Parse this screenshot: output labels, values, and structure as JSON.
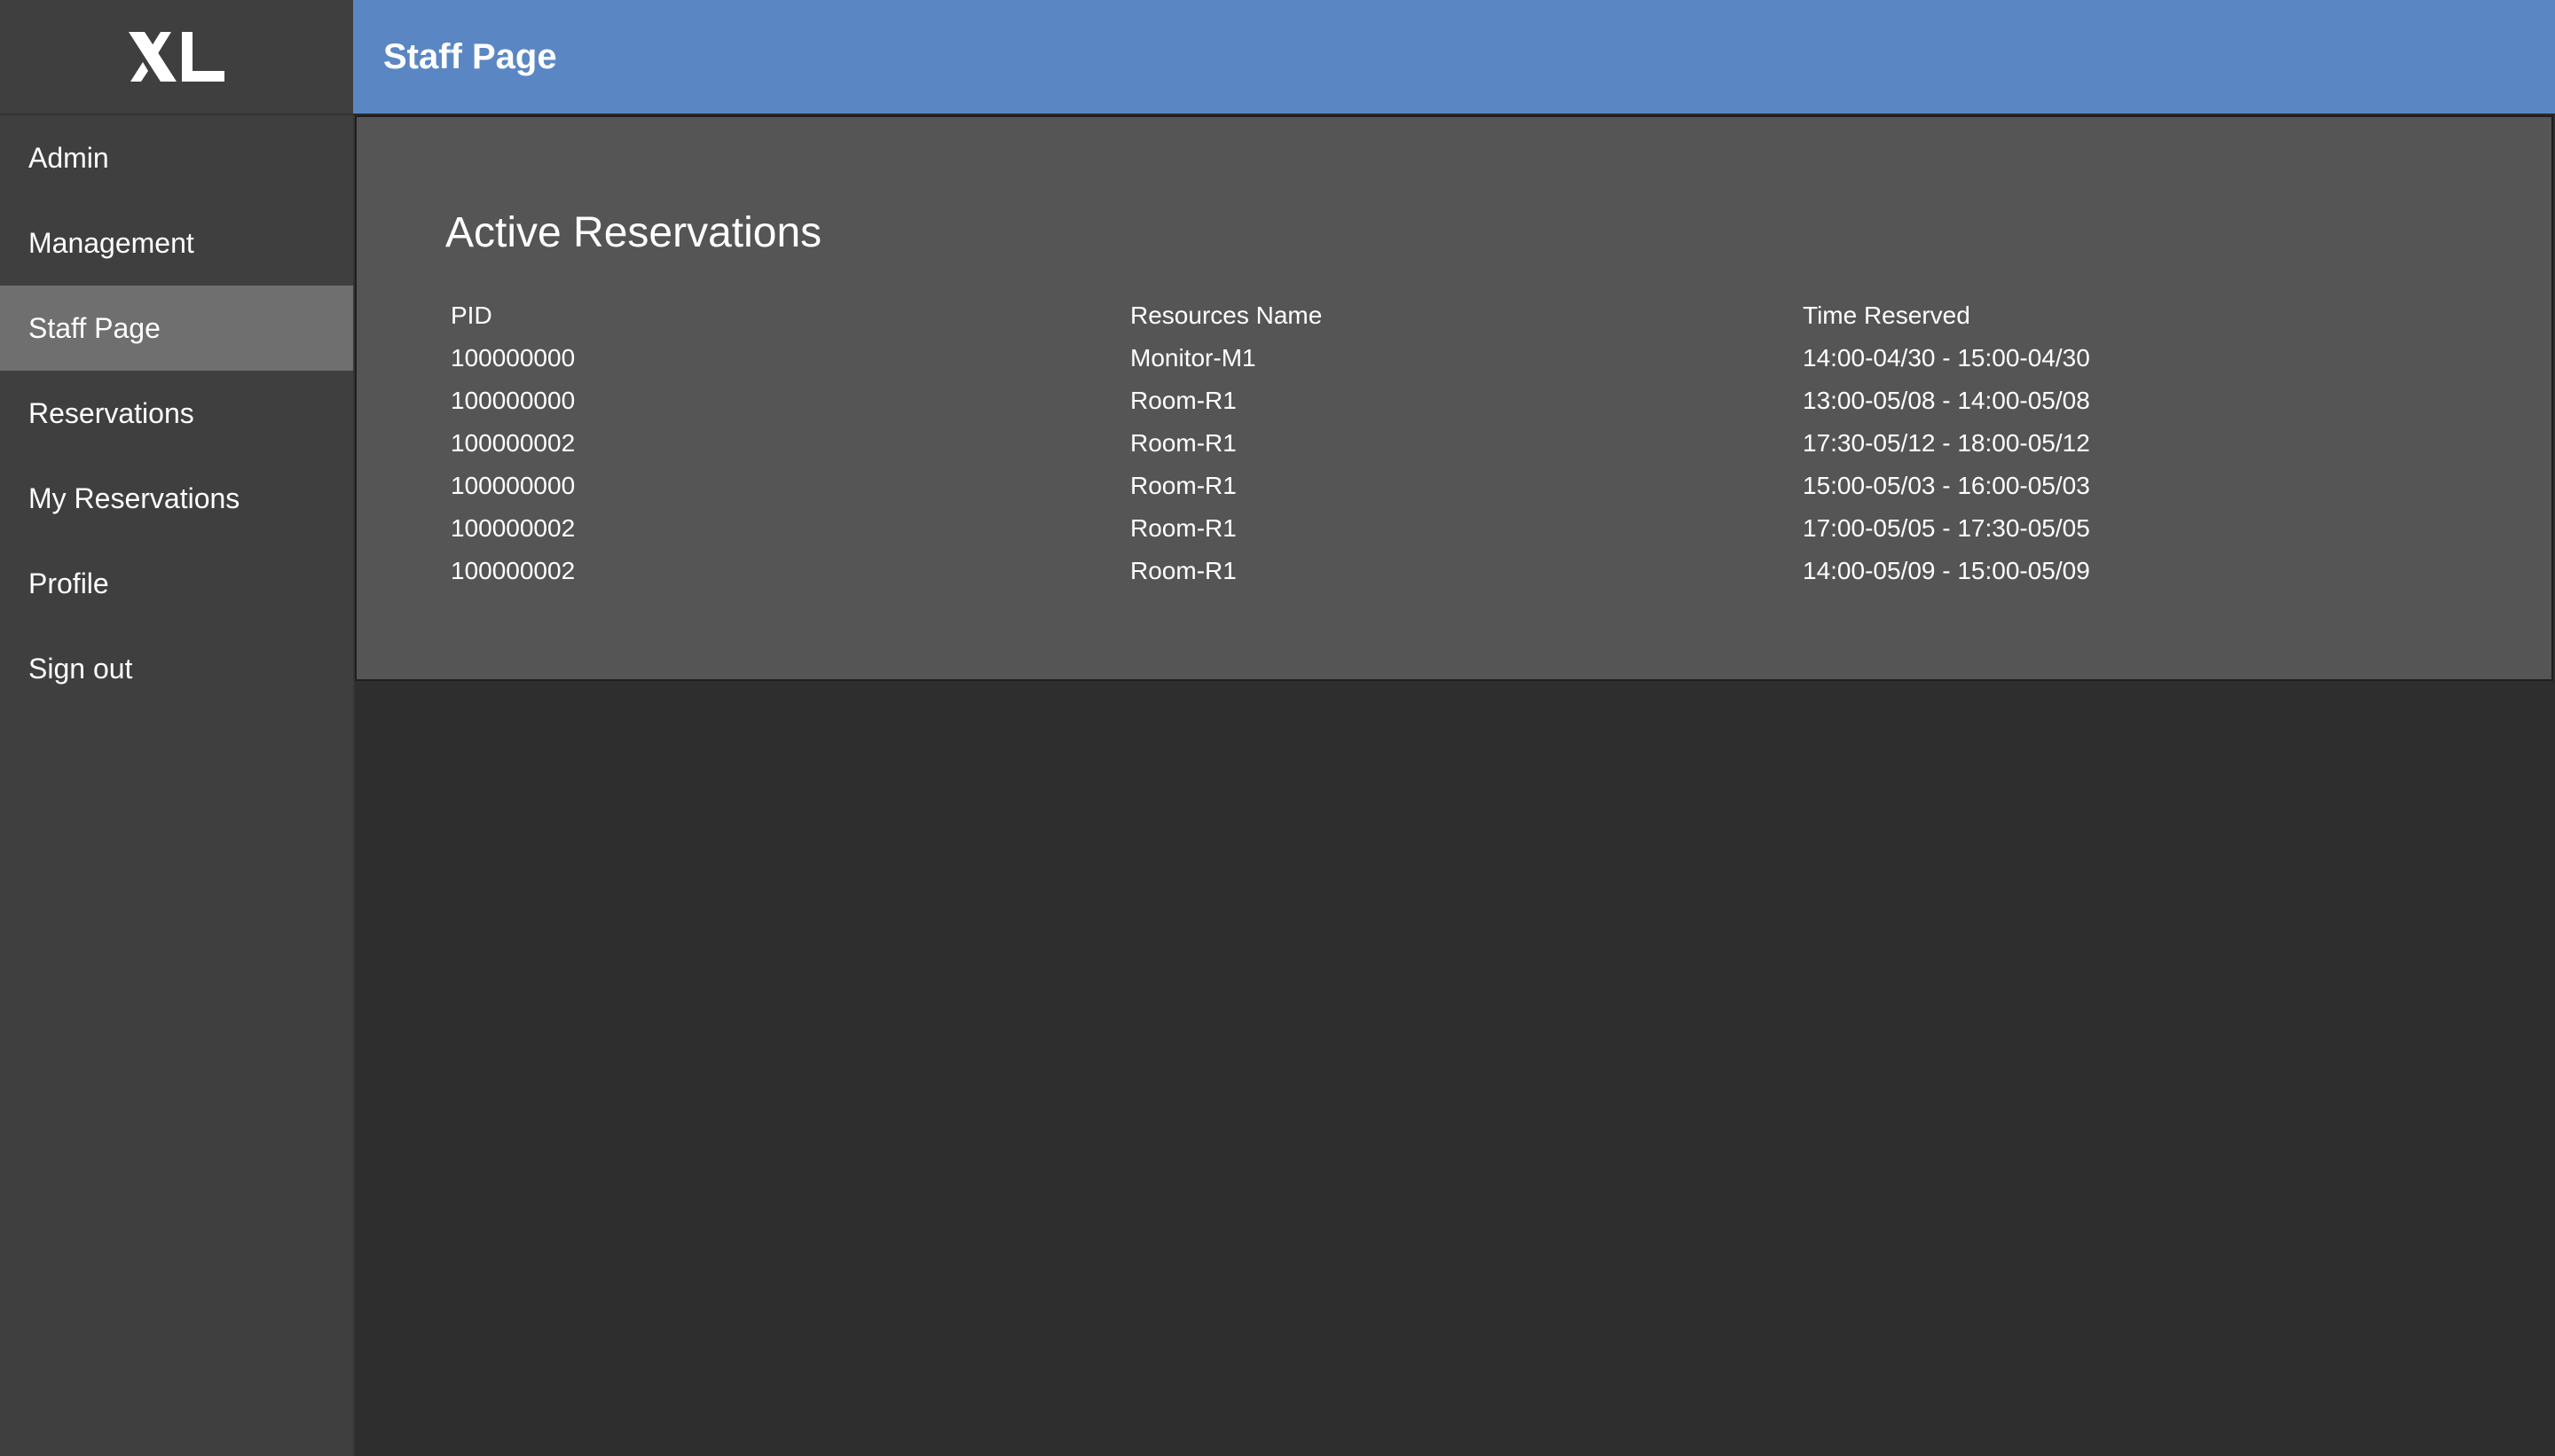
{
  "app": {
    "logo_text": "XL"
  },
  "sidebar": {
    "items": [
      {
        "label": "Admin",
        "name": "sidebar-item-admin",
        "active": false
      },
      {
        "label": "Management",
        "name": "sidebar-item-management",
        "active": false
      },
      {
        "label": "Staff Page",
        "name": "sidebar-item-staff-page",
        "active": true
      },
      {
        "label": "Reservations",
        "name": "sidebar-item-reservations",
        "active": false
      },
      {
        "label": "My Reservations",
        "name": "sidebar-item-my-reservations",
        "active": false
      },
      {
        "label": "Profile",
        "name": "sidebar-item-profile",
        "active": false
      },
      {
        "label": "Sign out",
        "name": "sidebar-item-sign-out",
        "active": false
      }
    ]
  },
  "header": {
    "title": "Staff Page"
  },
  "main": {
    "section_title": "Active Reservations",
    "table": {
      "columns": [
        "PID",
        "Resources Name",
        "Time Reserved"
      ],
      "rows": [
        [
          "100000000",
          "Monitor-M1",
          "14:00-04/30 - 15:00-04/30"
        ],
        [
          "100000000",
          "Room-R1",
          "13:00-05/08 - 14:00-05/08"
        ],
        [
          "100000002",
          "Room-R1",
          "17:30-05/12 - 18:00-05/12"
        ],
        [
          "100000000",
          "Room-R1",
          "15:00-05/03 - 16:00-05/03"
        ],
        [
          "100000002",
          "Room-R1",
          "17:00-05/05 - 17:30-05/05"
        ],
        [
          "100000002",
          "Room-R1",
          "14:00-05/09 - 15:00-05/09"
        ]
      ]
    }
  },
  "colors": {
    "header_bg": "#5a87c4",
    "sidebar_bg": "#3f3f3f",
    "sidebar_active_bg": "#6f6f6f",
    "panel_bg": "#555555",
    "page_bg": "#2e2e2e"
  }
}
